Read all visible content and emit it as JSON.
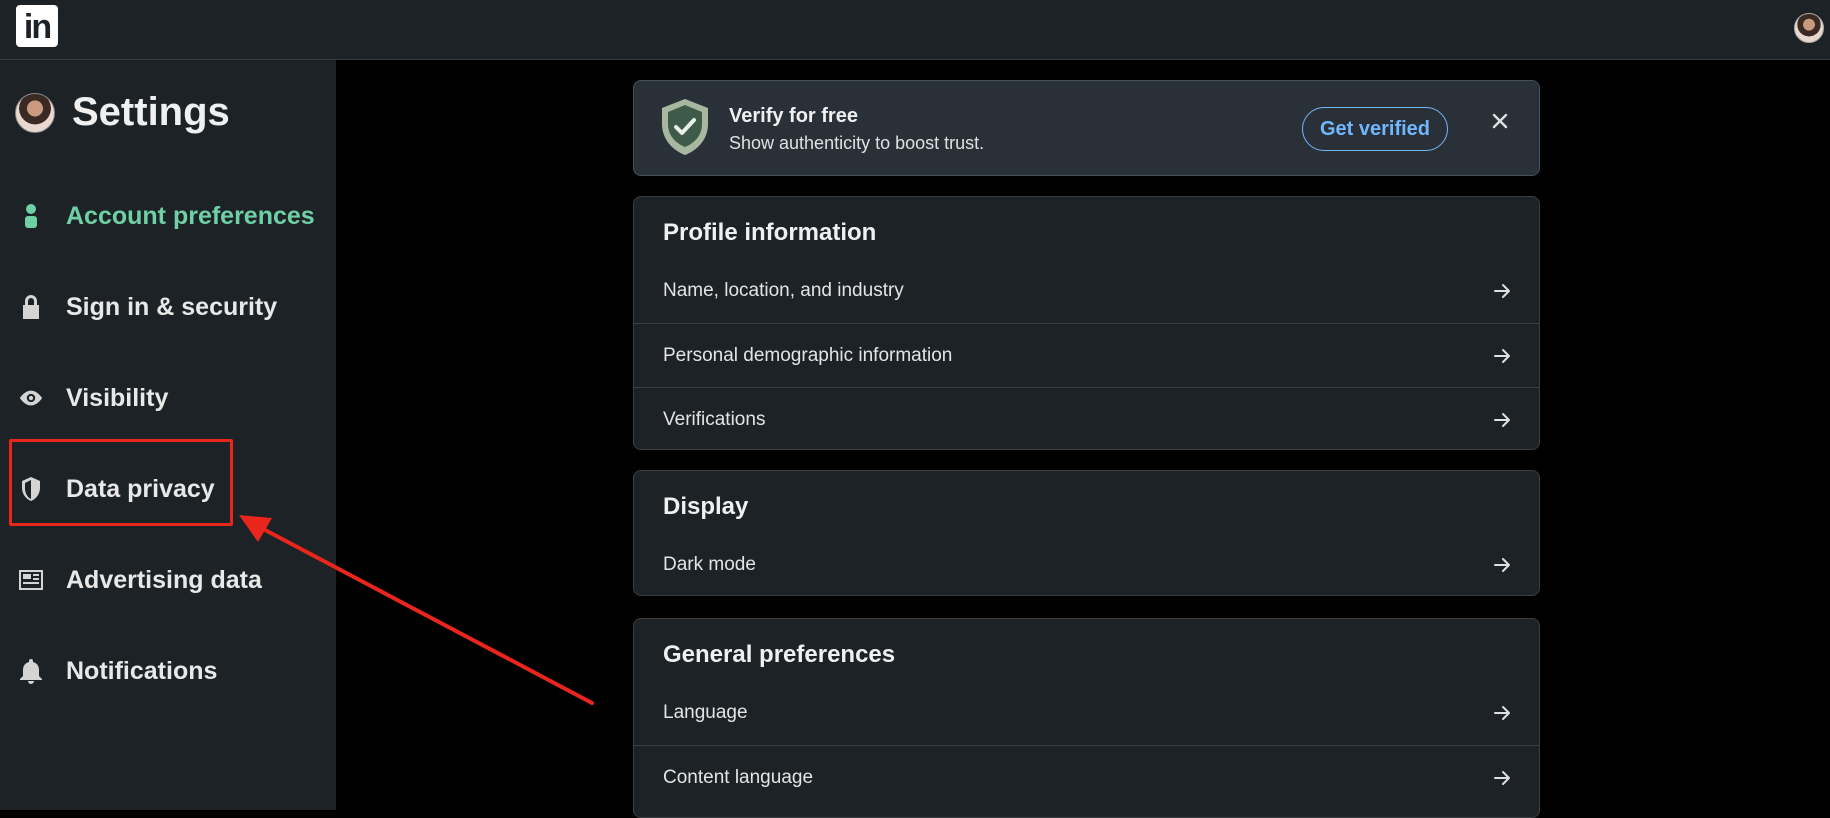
{
  "app": {
    "logo_text": "in"
  },
  "sidebar": {
    "title": "Settings",
    "items": [
      {
        "label": "Account preferences",
        "icon": "person-icon",
        "active": true
      },
      {
        "label": "Sign in & security",
        "icon": "lock-icon"
      },
      {
        "label": "Visibility",
        "icon": "eye-icon"
      },
      {
        "label": "Data privacy",
        "icon": "shield-icon"
      },
      {
        "label": "Advertising data",
        "icon": "newspaper-icon"
      },
      {
        "label": "Notifications",
        "icon": "bell-icon"
      }
    ]
  },
  "verify": {
    "title": "Verify for free",
    "subtitle": "Show authenticity to boost trust.",
    "button_label": "Get verified"
  },
  "sections": [
    {
      "title": "Profile information",
      "rows": [
        "Name, location, and industry",
        "Personal demographic information",
        "Verifications"
      ]
    },
    {
      "title": "Display",
      "rows": [
        "Dark mode"
      ]
    },
    {
      "title": "General preferences",
      "rows": [
        "Language",
        "Content language"
      ]
    }
  ],
  "colors": {
    "active_green": "#6fd0a5",
    "link_blue": "#71b7fb",
    "annotation_red": "#e8261c",
    "panel_bg": "#1d2226"
  }
}
